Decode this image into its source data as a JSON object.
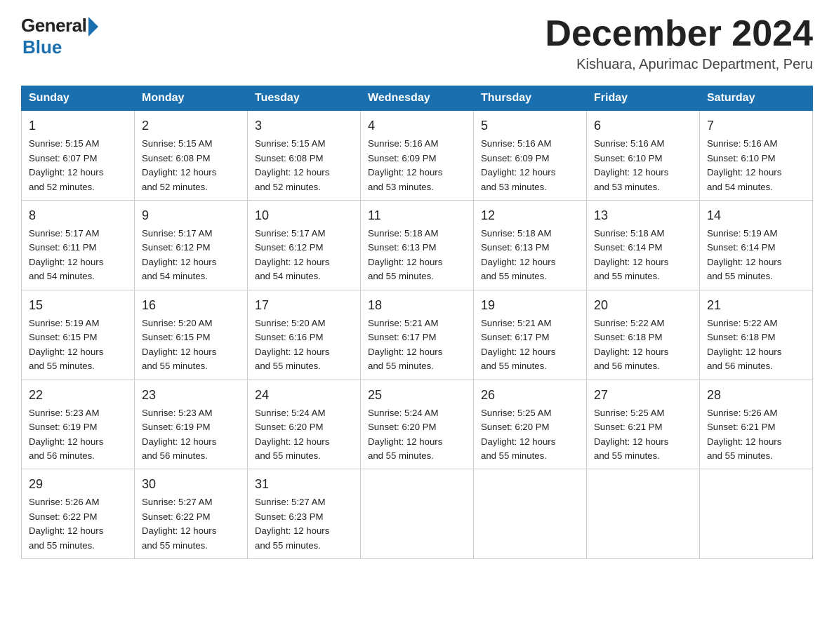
{
  "logo": {
    "general": "General",
    "blue": "Blue"
  },
  "title": "December 2024",
  "subtitle": "Kishuara, Apurimac Department, Peru",
  "days_of_week": [
    "Sunday",
    "Monday",
    "Tuesday",
    "Wednesday",
    "Thursday",
    "Friday",
    "Saturday"
  ],
  "weeks": [
    [
      {
        "day": "1",
        "sunrise": "5:15 AM",
        "sunset": "6:07 PM",
        "daylight": "12 hours and 52 minutes."
      },
      {
        "day": "2",
        "sunrise": "5:15 AM",
        "sunset": "6:08 PM",
        "daylight": "12 hours and 52 minutes."
      },
      {
        "day": "3",
        "sunrise": "5:15 AM",
        "sunset": "6:08 PM",
        "daylight": "12 hours and 52 minutes."
      },
      {
        "day": "4",
        "sunrise": "5:16 AM",
        "sunset": "6:09 PM",
        "daylight": "12 hours and 53 minutes."
      },
      {
        "day": "5",
        "sunrise": "5:16 AM",
        "sunset": "6:09 PM",
        "daylight": "12 hours and 53 minutes."
      },
      {
        "day": "6",
        "sunrise": "5:16 AM",
        "sunset": "6:10 PM",
        "daylight": "12 hours and 53 minutes."
      },
      {
        "day": "7",
        "sunrise": "5:16 AM",
        "sunset": "6:10 PM",
        "daylight": "12 hours and 54 minutes."
      }
    ],
    [
      {
        "day": "8",
        "sunrise": "5:17 AM",
        "sunset": "6:11 PM",
        "daylight": "12 hours and 54 minutes."
      },
      {
        "day": "9",
        "sunrise": "5:17 AM",
        "sunset": "6:12 PM",
        "daylight": "12 hours and 54 minutes."
      },
      {
        "day": "10",
        "sunrise": "5:17 AM",
        "sunset": "6:12 PM",
        "daylight": "12 hours and 54 minutes."
      },
      {
        "day": "11",
        "sunrise": "5:18 AM",
        "sunset": "6:13 PM",
        "daylight": "12 hours and 55 minutes."
      },
      {
        "day": "12",
        "sunrise": "5:18 AM",
        "sunset": "6:13 PM",
        "daylight": "12 hours and 55 minutes."
      },
      {
        "day": "13",
        "sunrise": "5:18 AM",
        "sunset": "6:14 PM",
        "daylight": "12 hours and 55 minutes."
      },
      {
        "day": "14",
        "sunrise": "5:19 AM",
        "sunset": "6:14 PM",
        "daylight": "12 hours and 55 minutes."
      }
    ],
    [
      {
        "day": "15",
        "sunrise": "5:19 AM",
        "sunset": "6:15 PM",
        "daylight": "12 hours and 55 minutes."
      },
      {
        "day": "16",
        "sunrise": "5:20 AM",
        "sunset": "6:15 PM",
        "daylight": "12 hours and 55 minutes."
      },
      {
        "day": "17",
        "sunrise": "5:20 AM",
        "sunset": "6:16 PM",
        "daylight": "12 hours and 55 minutes."
      },
      {
        "day": "18",
        "sunrise": "5:21 AM",
        "sunset": "6:17 PM",
        "daylight": "12 hours and 55 minutes."
      },
      {
        "day": "19",
        "sunrise": "5:21 AM",
        "sunset": "6:17 PM",
        "daylight": "12 hours and 55 minutes."
      },
      {
        "day": "20",
        "sunrise": "5:22 AM",
        "sunset": "6:18 PM",
        "daylight": "12 hours and 56 minutes."
      },
      {
        "day": "21",
        "sunrise": "5:22 AM",
        "sunset": "6:18 PM",
        "daylight": "12 hours and 56 minutes."
      }
    ],
    [
      {
        "day": "22",
        "sunrise": "5:23 AM",
        "sunset": "6:19 PM",
        "daylight": "12 hours and 56 minutes."
      },
      {
        "day": "23",
        "sunrise": "5:23 AM",
        "sunset": "6:19 PM",
        "daylight": "12 hours and 56 minutes."
      },
      {
        "day": "24",
        "sunrise": "5:24 AM",
        "sunset": "6:20 PM",
        "daylight": "12 hours and 55 minutes."
      },
      {
        "day": "25",
        "sunrise": "5:24 AM",
        "sunset": "6:20 PM",
        "daylight": "12 hours and 55 minutes."
      },
      {
        "day": "26",
        "sunrise": "5:25 AM",
        "sunset": "6:20 PM",
        "daylight": "12 hours and 55 minutes."
      },
      {
        "day": "27",
        "sunrise": "5:25 AM",
        "sunset": "6:21 PM",
        "daylight": "12 hours and 55 minutes."
      },
      {
        "day": "28",
        "sunrise": "5:26 AM",
        "sunset": "6:21 PM",
        "daylight": "12 hours and 55 minutes."
      }
    ],
    [
      {
        "day": "29",
        "sunrise": "5:26 AM",
        "sunset": "6:22 PM",
        "daylight": "12 hours and 55 minutes."
      },
      {
        "day": "30",
        "sunrise": "5:27 AM",
        "sunset": "6:22 PM",
        "daylight": "12 hours and 55 minutes."
      },
      {
        "day": "31",
        "sunrise": "5:27 AM",
        "sunset": "6:23 PM",
        "daylight": "12 hours and 55 minutes."
      },
      null,
      null,
      null,
      null
    ]
  ],
  "labels": {
    "sunrise": "Sunrise:",
    "sunset": "Sunset:",
    "daylight": "Daylight:"
  }
}
